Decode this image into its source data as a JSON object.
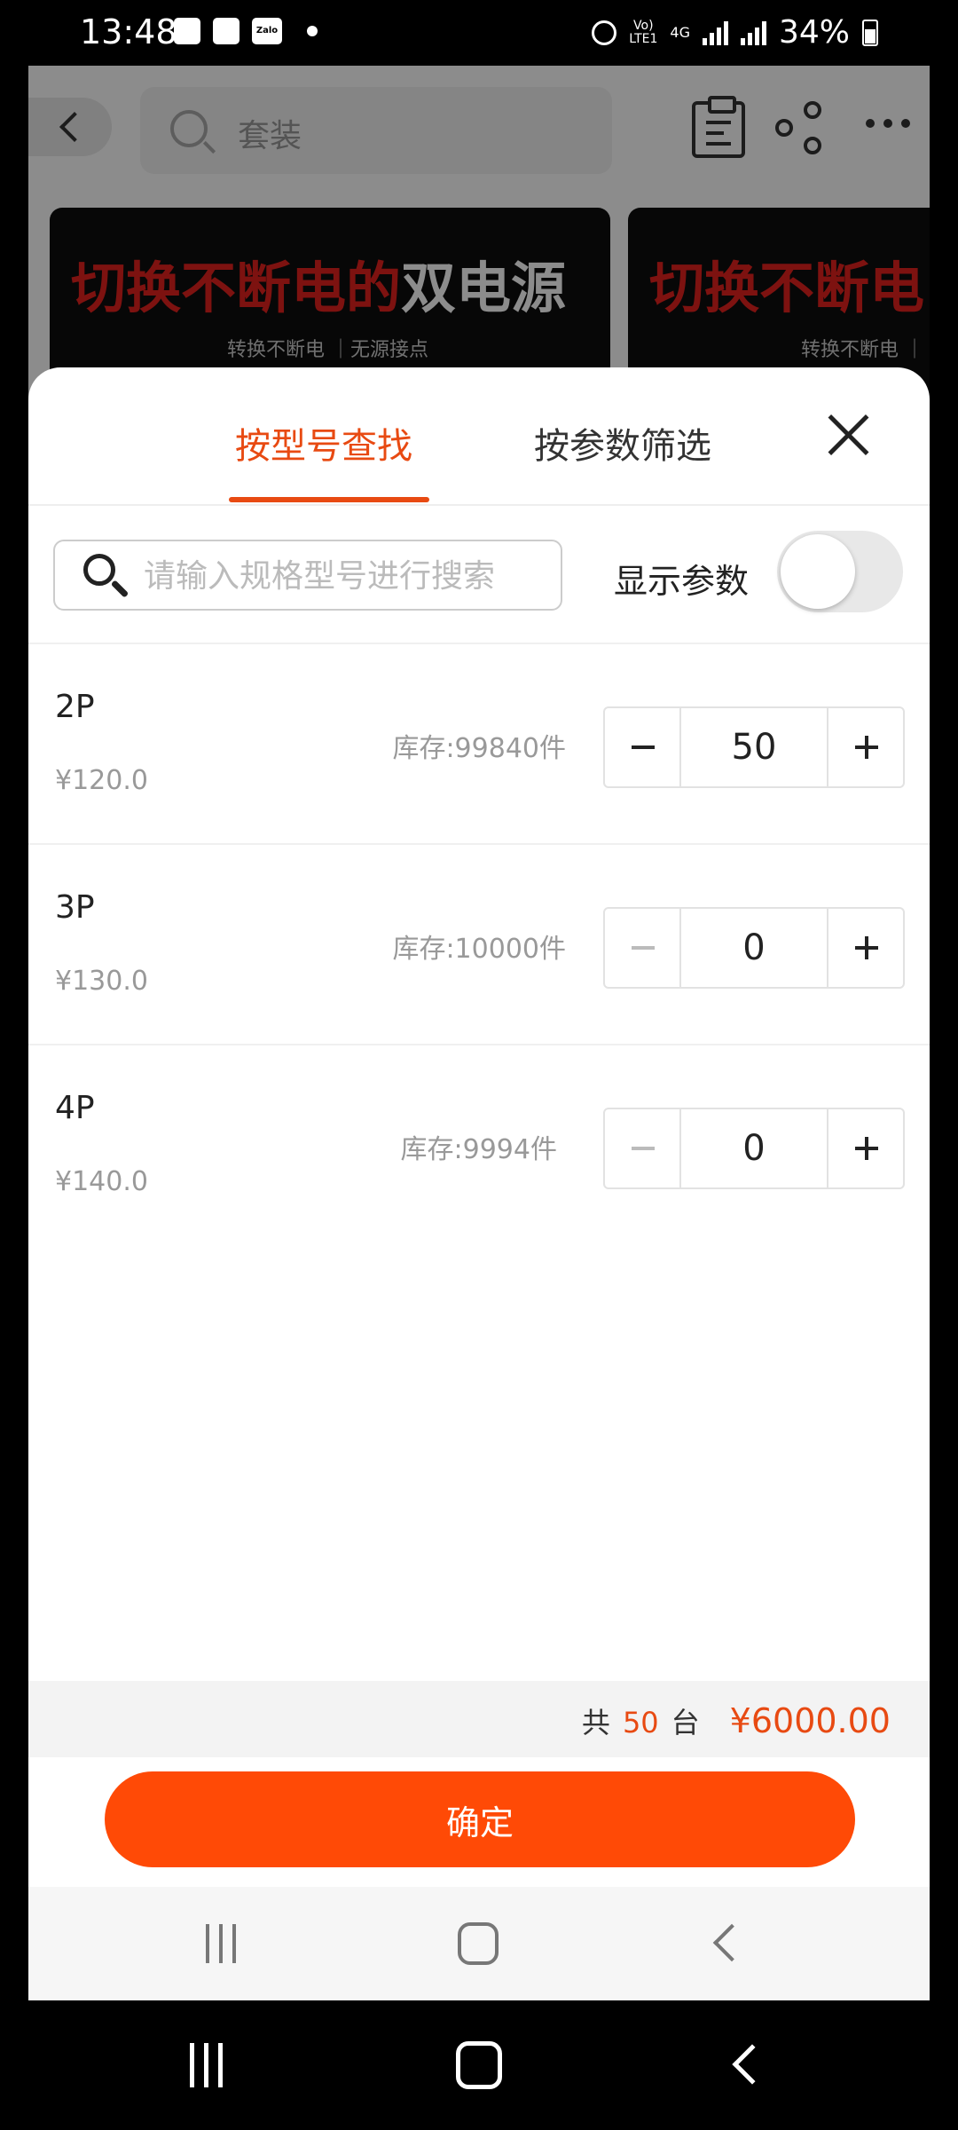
{
  "status_bar": {
    "time": "13:48",
    "network_top": "Vo)",
    "network_bottom": "LTE1",
    "data_type": "4G",
    "battery": "34%",
    "left_icons": [
      "gallery-icon",
      "tiktok-icon",
      "zalo-icon",
      "notification-dot"
    ],
    "zalo_text": "Zalo"
  },
  "top_nav": {
    "search_placeholder": "套装"
  },
  "banners": [
    {
      "title_red": "切换不断电的",
      "title_white": "双电源",
      "subtitle": "转换不断电 ｜无源接点"
    },
    {
      "title_red": "切换不断电",
      "title_white": "",
      "subtitle": "转换不断电 ｜"
    }
  ],
  "sheet": {
    "tabs": [
      {
        "label": "按型号查找",
        "active": true
      },
      {
        "label": "按参数筛选",
        "active": false
      }
    ],
    "search_placeholder": "请输入规格型号进行搜索",
    "show_params_label": "显示参数",
    "show_params_on": false,
    "specs": [
      {
        "name": "2P",
        "price": "¥120.0",
        "stock": "库存:99840件",
        "qty": "50"
      },
      {
        "name": "3P",
        "price": "¥130.0",
        "stock": "库存:10000件",
        "qty": "0"
      },
      {
        "name": "4P",
        "price": "¥140.0",
        "stock": "库存:9994件",
        "qty": "0"
      }
    ],
    "total": {
      "prefix": "共",
      "count": "50",
      "unit": "台",
      "amount": "¥6000.00"
    },
    "confirm_label": "确定"
  },
  "colors": {
    "accent": "#e84a12",
    "confirm_button": "#ff4a06",
    "banner_red": "#e4221e"
  }
}
